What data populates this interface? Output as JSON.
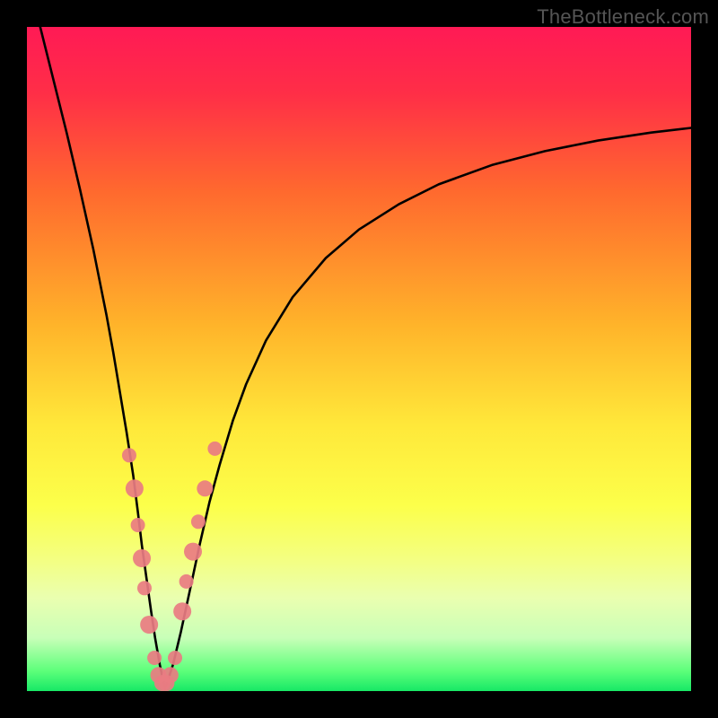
{
  "watermark": "TheBottleneck.com",
  "chart_data": {
    "type": "line",
    "title": "",
    "xlabel": "",
    "ylabel": "",
    "xlim": [
      0,
      100
    ],
    "ylim": [
      0,
      100
    ],
    "grid": false,
    "legend": false,
    "gradient_stops": [
      {
        "pct": 0,
        "color": "#ff1a55"
      },
      {
        "pct": 10,
        "color": "#ff2e47"
      },
      {
        "pct": 25,
        "color": "#ff6a2e"
      },
      {
        "pct": 45,
        "color": "#ffb42a"
      },
      {
        "pct": 60,
        "color": "#ffe83a"
      },
      {
        "pct": 72,
        "color": "#fcff4a"
      },
      {
        "pct": 80,
        "color": "#f4ff80"
      },
      {
        "pct": 86,
        "color": "#eaffb0"
      },
      {
        "pct": 92,
        "color": "#c8ffb8"
      },
      {
        "pct": 97,
        "color": "#5cff7a"
      },
      {
        "pct": 100,
        "color": "#17e866"
      }
    ],
    "series": [
      {
        "name": "left_branch",
        "x": [
          2,
          4,
          6,
          8,
          10,
          12,
          13,
          14,
          15,
          16,
          16.7,
          17.3,
          18,
          18.7,
          19.3,
          20,
          20.8
        ],
        "y": [
          100,
          92,
          84,
          75.5,
          66.5,
          56.5,
          51,
          45,
          39,
          32.5,
          27,
          22,
          17,
          12,
          8,
          4,
          0.3
        ]
      },
      {
        "name": "right_branch",
        "x": [
          20.8,
          22,
          23.2,
          24.5,
          26,
          27.5,
          29,
          31,
          33,
          36,
          40,
          45,
          50,
          56,
          62,
          70,
          78,
          86,
          94,
          100
        ],
        "y": [
          0.3,
          4,
          9,
          15,
          22,
          28.5,
          34,
          40.7,
          46.2,
          52.8,
          59.3,
          65.2,
          69.5,
          73.3,
          76.3,
          79.2,
          81.3,
          82.9,
          84.1,
          84.8
        ]
      }
    ],
    "markers": {
      "name": "highlighted_points",
      "color": "#e97c82",
      "points": [
        {
          "x": 15.4,
          "y": 35.5,
          "r": 8
        },
        {
          "x": 16.2,
          "y": 30.5,
          "r": 10
        },
        {
          "x": 16.7,
          "y": 25.0,
          "r": 8
        },
        {
          "x": 17.3,
          "y": 20.0,
          "r": 10
        },
        {
          "x": 17.7,
          "y": 15.5,
          "r": 8
        },
        {
          "x": 18.4,
          "y": 10.0,
          "r": 10
        },
        {
          "x": 19.2,
          "y": 5.0,
          "r": 8
        },
        {
          "x": 19.8,
          "y": 2.4,
          "r": 9
        },
        {
          "x": 20.4,
          "y": 1.2,
          "r": 9
        },
        {
          "x": 21.0,
          "y": 1.2,
          "r": 9
        },
        {
          "x": 21.6,
          "y": 2.4,
          "r": 9
        },
        {
          "x": 22.3,
          "y": 5.0,
          "r": 8
        },
        {
          "x": 23.4,
          "y": 12.0,
          "r": 10
        },
        {
          "x": 24.0,
          "y": 16.5,
          "r": 8
        },
        {
          "x": 25.0,
          "y": 21.0,
          "r": 10
        },
        {
          "x": 25.8,
          "y": 25.5,
          "r": 8
        },
        {
          "x": 26.8,
          "y": 30.5,
          "r": 9
        },
        {
          "x": 28.3,
          "y": 36.5,
          "r": 8
        }
      ]
    },
    "annotations": []
  }
}
